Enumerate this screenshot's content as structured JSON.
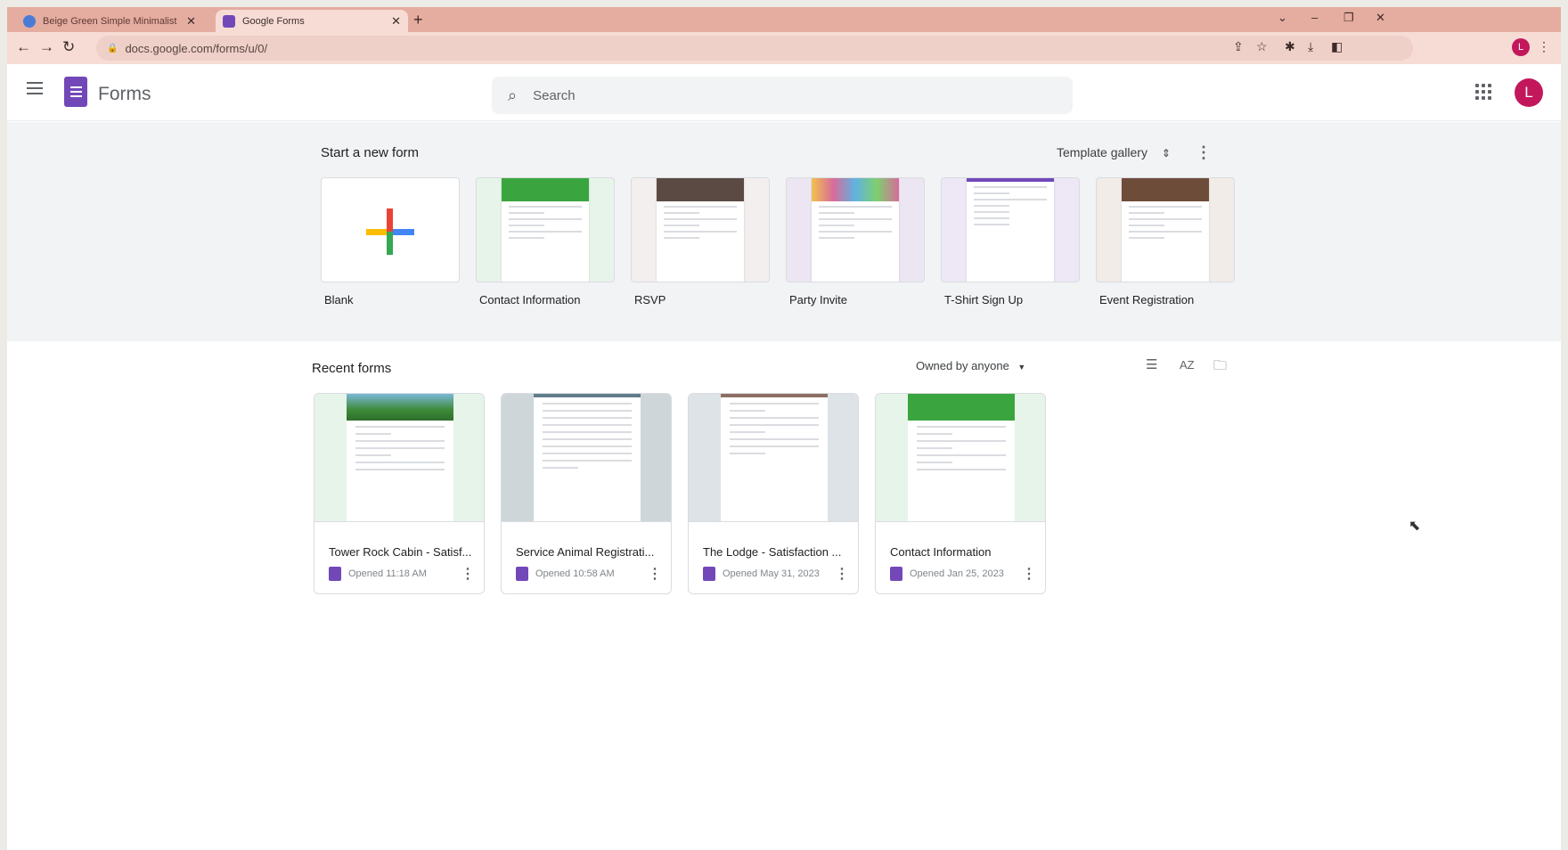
{
  "browser": {
    "tabs": [
      {
        "title": "Beige Green Simple Minimalist",
        "close": "✕"
      },
      {
        "title": "Google Forms",
        "close": "✕"
      }
    ],
    "new_tab": "+",
    "url": "docs.google.com/forms/u/0/"
  },
  "header": {
    "app_name": "Forms",
    "search_placeholder": "Search",
    "account_initial": "L"
  },
  "start": {
    "title": "Start a new form",
    "template_gallery": "Template gallery",
    "templates": [
      {
        "name": "Blank"
      },
      {
        "name": "Contact Information",
        "color": "#3aa53f"
      },
      {
        "name": "RSVP",
        "color": "#5b4a44"
      },
      {
        "name": "Party Invite",
        "color": "#d86b9a"
      },
      {
        "name": "T-Shirt Sign Up",
        "color": "#7248b9"
      },
      {
        "name": "Event Registration",
        "color": "#6d4c3a"
      }
    ]
  },
  "recent": {
    "title": "Recent forms",
    "owner_filter": "Owned by anyone",
    "forms": [
      {
        "title": "Tower Rock Cabin - Satisf...",
        "opened": "Opened 11:18 AM"
      },
      {
        "title": "Service Animal Registrati...",
        "opened": "Opened 10:58 AM"
      },
      {
        "title": "The Lodge - Satisfaction ...",
        "opened": "Opened May 31, 2023"
      },
      {
        "title": "Contact Information",
        "opened": "Opened Jan 25, 2023"
      }
    ]
  },
  "colors": {
    "forms_purple": "#7248b9",
    "tab_bar": "#e5aca0"
  }
}
